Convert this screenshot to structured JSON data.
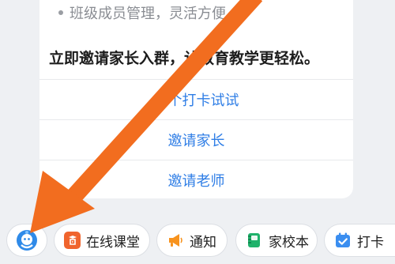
{
  "card": {
    "bullet_text": "班级成员管理，灵活方便",
    "headline": "立即邀请家长入群，让教育教学更轻松。",
    "actions": [
      {
        "label": "发个打卡试试"
      },
      {
        "label": "邀请家长"
      },
      {
        "label": "邀请老师"
      }
    ]
  },
  "bottom_bar": {
    "items": [
      {
        "label": "",
        "icon": "assistant-avatar-icon"
      },
      {
        "label": "在线课堂",
        "icon": "online-classroom-icon"
      },
      {
        "label": "通知",
        "icon": "megaphone-icon"
      },
      {
        "label": "家校本",
        "icon": "notebook-icon"
      },
      {
        "label": "打卡",
        "icon": "calendar-check-icon"
      }
    ]
  },
  "colors": {
    "link_blue": "#2f7ee6",
    "annotation_arrow": "#f26d1f",
    "classroom_orange": "#f0642d",
    "notice_orange": "#f7931e",
    "notebook_green": "#1fb26b",
    "checkin_blue": "#3a8ef0"
  }
}
